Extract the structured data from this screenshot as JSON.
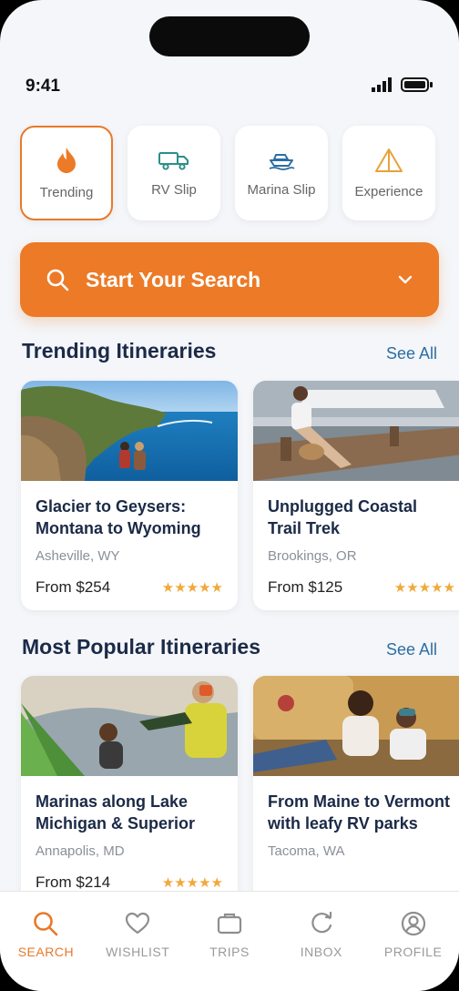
{
  "status": {
    "time": "9:41"
  },
  "categories": [
    {
      "label": "Trending",
      "icon": "flame-icon",
      "active": true
    },
    {
      "label": "RV Slip",
      "icon": "truck-icon",
      "active": false
    },
    {
      "label": "Marina Slip",
      "icon": "boat-icon",
      "active": false
    },
    {
      "label": "Experience",
      "icon": "tent-icon",
      "active": false
    }
  ],
  "search": {
    "label": "Start Your Search"
  },
  "trending": {
    "title": "Trending Itineraries",
    "see_all": "See All",
    "cards": [
      {
        "title": "Glacier to Geysers: Montana to Wyoming",
        "location": "Asheville, WY",
        "price": "From $254",
        "stars": "★★★★★"
      },
      {
        "title": "Unplugged Coastal Trail Trek",
        "location": "Brookings, OR",
        "price": "From $125",
        "stars": "★★★★★"
      }
    ]
  },
  "popular": {
    "title": "Most Popular Itineraries",
    "see_all": "See All",
    "cards": [
      {
        "title": "Marinas along Lake Michigan & Superior",
        "location": "Annapolis, MD",
        "price": "From $214",
        "stars": "★★★★★"
      },
      {
        "title": "From Maine to Vermont with leafy RV parks",
        "location": "Tacoma, WA"
      }
    ]
  },
  "nav": [
    {
      "label": "SEARCH",
      "icon": "search-icon"
    },
    {
      "label": "WISHLIST",
      "icon": "heart-icon"
    },
    {
      "label": "TRIPS",
      "icon": "suitcase-icon"
    },
    {
      "label": "INBOX",
      "icon": "chat-icon"
    },
    {
      "label": "PROFILE",
      "icon": "profile-icon"
    }
  ],
  "colors": {
    "accent": "#ec7a27",
    "navy": "#1b2a47",
    "link": "#2d6ea3",
    "teal": "#2a8f88",
    "star": "#f0a93a"
  }
}
